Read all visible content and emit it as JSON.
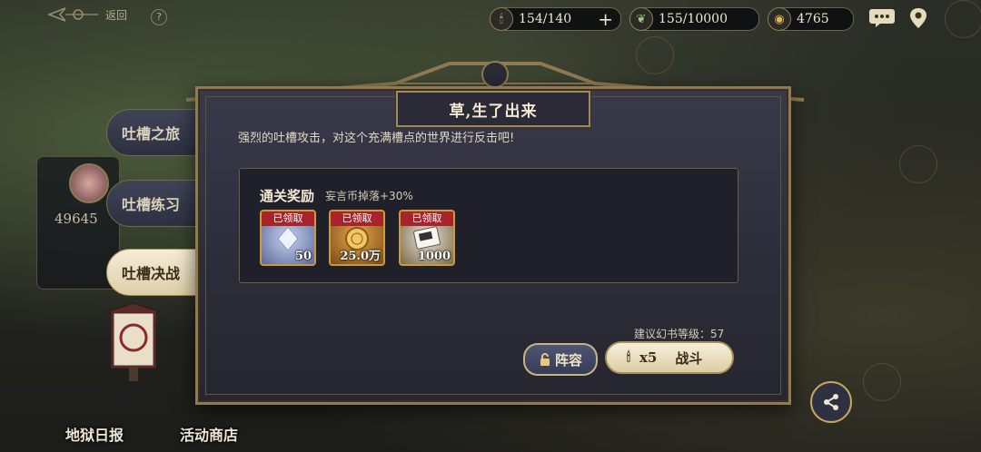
{
  "top": {
    "back_label": "返回",
    "help": "?",
    "stamina": {
      "value": "154/140",
      "icon": "candle-icon"
    },
    "herb": {
      "value": "155/10000",
      "icon": "herb-icon"
    },
    "coins": {
      "value": "4765",
      "icon": "coin-icon"
    },
    "chat_icon": "chat-bubble-icon",
    "map_icon": "location-pin-icon"
  },
  "sidebar": {
    "tabs": [
      {
        "label": "吐槽之旅",
        "active": false
      },
      {
        "label": "吐槽练习",
        "active": false
      },
      {
        "label": "吐槽决战",
        "active": true
      }
    ],
    "power": "49645"
  },
  "dialog": {
    "title": "草,生了出来",
    "description": "强烈的吐槽攻击，对这个充满槽点的世界进行反击吧!",
    "rewards_title": "通关奖励",
    "rewards_bonus": "妄言币掉落+30%",
    "rewards": [
      {
        "ribbon": "已领取",
        "qty": "50",
        "icon": "feather-crystal-icon"
      },
      {
        "ribbon": "已领取",
        "qty": "25.0万",
        "icon": "gold-coin-icon"
      },
      {
        "ribbon": "已领取",
        "qty": "1000",
        "icon": "exp-ticket-icon"
      }
    ],
    "recommended_level": "建议幻书等级：57",
    "team_button": "阵容",
    "fight_cost": "x5",
    "fight_button": "战斗"
  },
  "bottom": {
    "daily": "地狱日报",
    "shop": "活动商店"
  },
  "colors": {
    "gold_border": "#a08a5a",
    "ribbon_red": "#a8232a",
    "dialog_bg": "#2d2d3a"
  }
}
